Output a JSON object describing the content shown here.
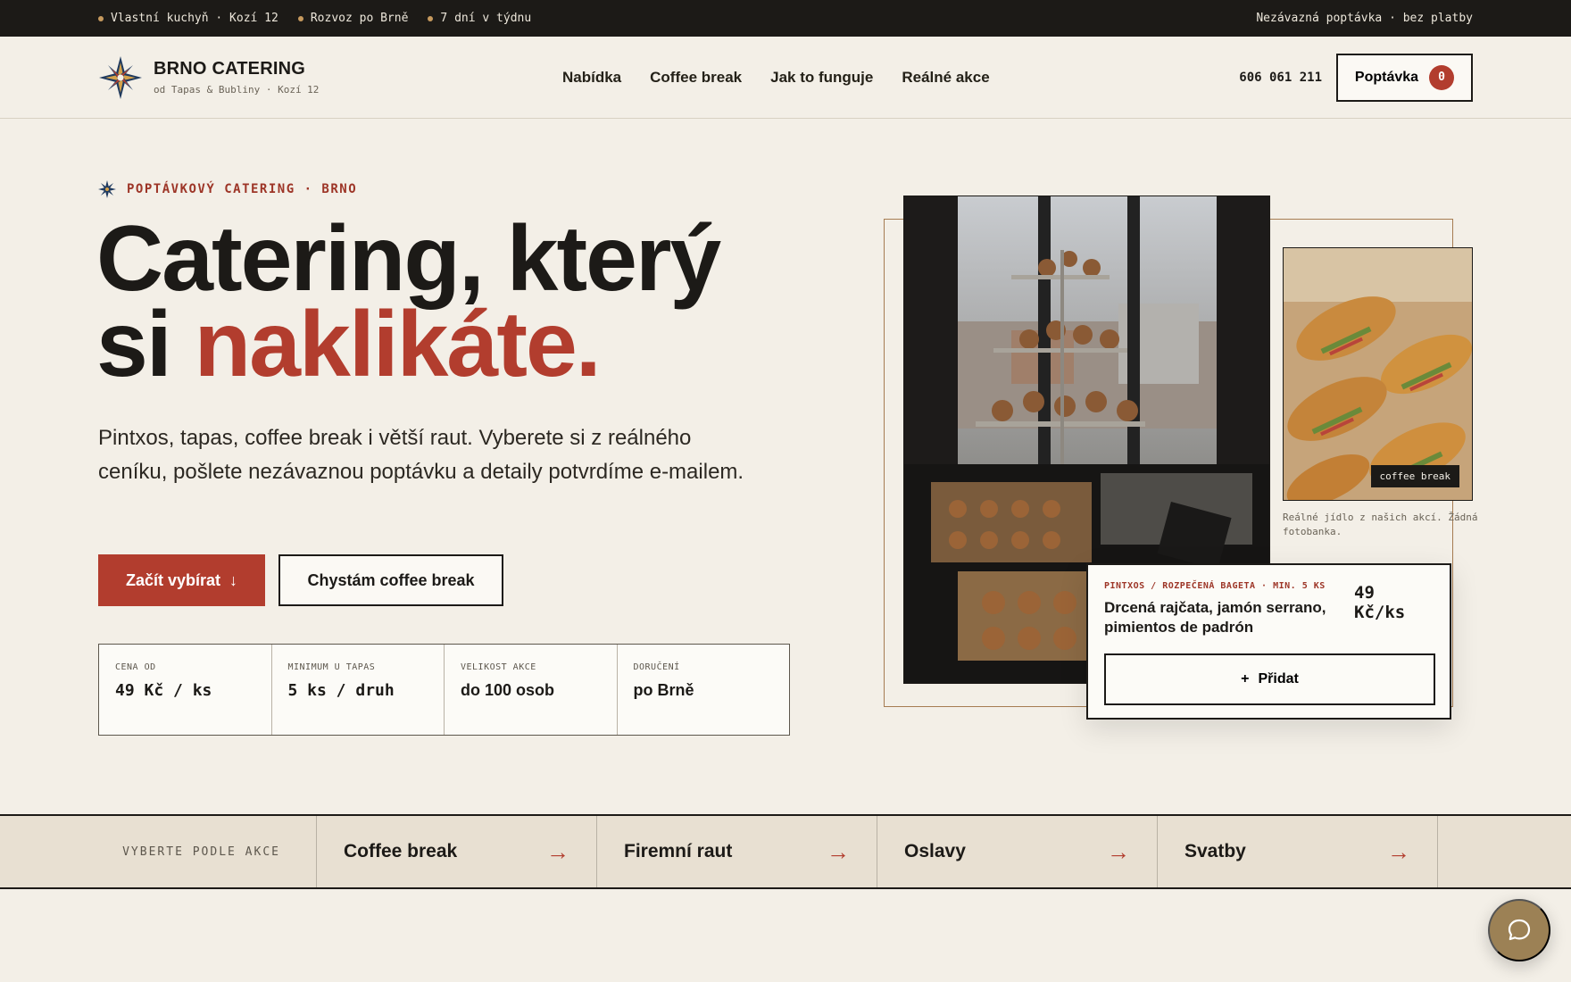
{
  "topbar": {
    "items": [
      "Vlastní kuchyň · Kozí 12",
      "Rozvoz po Brně",
      "7 dní v týdnu"
    ],
    "right": "Nezávazná poptávka · bez platby"
  },
  "brand": {
    "name": "BRNO CATERING",
    "sub": "od Tapas & Bubliny · Kozí 12"
  },
  "nav": [
    "Nabídka",
    "Coffee break",
    "Jak to funguje",
    "Reálné akce"
  ],
  "header": {
    "phone": "606 061 211",
    "inquiry_label": "Poptávka",
    "inquiry_count": "0"
  },
  "hero": {
    "eyebrow": "POPTÁVKOVÝ CATERING · BRNO",
    "headline_1": "Catering, který",
    "headline_2a": "si ",
    "headline_2b": "naklikáte.",
    "lead": "Pintxos, tapas, coffee break i větší raut. Vyberete si z reálného ceníku, pošlete nezávaznou poptávku a detaily potvrdíme e-mailem.",
    "cta_primary": "Začít vybírat",
    "cta_primary_icon": "↓",
    "cta_secondary": "Chystám coffee break"
  },
  "facts": [
    {
      "label": "CENA OD",
      "value": "49 Kč / ks",
      "mono": true
    },
    {
      "label": "MINIMUM U TAPAS",
      "value": "5 ks / druh",
      "mono": true
    },
    {
      "label": "VELIKOST AKCE",
      "value": "do 100 osob",
      "mono": false
    },
    {
      "label": "DORUČENÍ",
      "value": "po Brně",
      "mono": false
    }
  ],
  "photos": {
    "side_tag": "coffee break",
    "caption": "Reálné jídlo z našich akcí. Žádná fotobanka."
  },
  "product": {
    "category": "PINTXOS / ROZPEČENÁ BAGETA · MIN. 5 KS",
    "name": "Drcená rajčata, jamón serrano, pimientos de padrón",
    "price": "49 Kč/ks",
    "add_icon": "+",
    "add_label": "Přidat"
  },
  "strip": {
    "label": "VYBERTE PODLE AKCE",
    "items": [
      "Coffee break",
      "Firemní raut",
      "Oslavy",
      "Svatby"
    ],
    "arrow": "→"
  },
  "colors": {
    "accent": "#b23d2e",
    "dark": "#1c1a17",
    "background": "#f3efe7",
    "gold": "#a67c52"
  }
}
